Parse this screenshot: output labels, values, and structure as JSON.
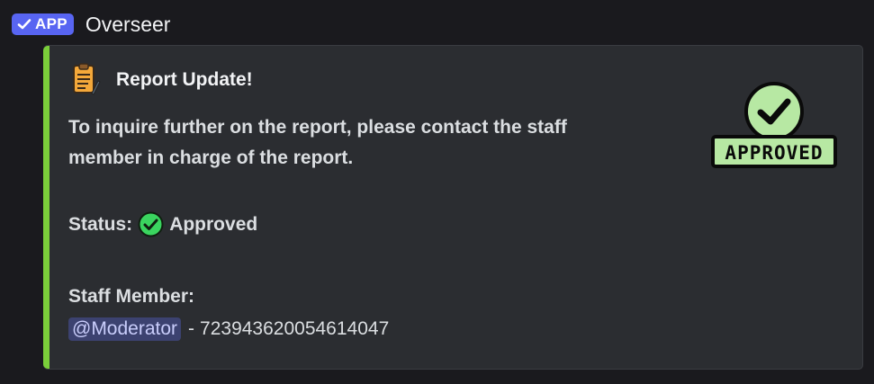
{
  "header": {
    "badge_label": "APP",
    "author": "Overseer"
  },
  "embed": {
    "accent_color": "#7acf3a",
    "title": "Report Update!",
    "title_icon": "clipboard-notes-icon",
    "description": "To inquire further on the report, please contact the staff member in charge of the report.",
    "status_label": "Status:",
    "status_value": "Approved",
    "staff_label": "Staff Member:",
    "staff_mention": "@Moderator",
    "staff_separator": "-",
    "staff_id": "723943620054614047",
    "thumbnail": {
      "icon": "approved-stamp-icon",
      "text": "APPROVED"
    }
  }
}
